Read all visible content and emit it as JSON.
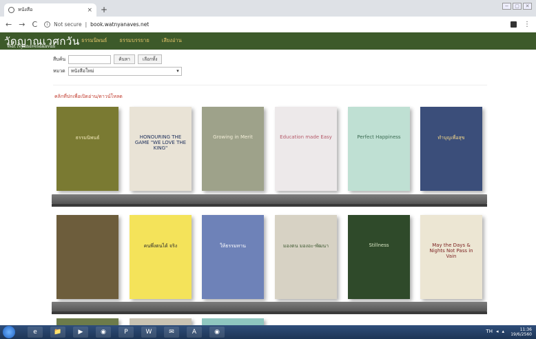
{
  "browser": {
    "tab_title": "หนังสือ",
    "tab_close": "×",
    "new_tab": "+",
    "security": "Not secure",
    "url": "book.watnyanaves.net",
    "win_buttons": [
      "−",
      "▢",
      "✕"
    ]
  },
  "site": {
    "logo_th": "วัดญาณเวศกวัน",
    "logo_en": "Wat Nyanavesakavan",
    "menu": [
      "ธรรมนิพนธ์",
      "ธรรมบรรยาย",
      "เสียงอ่าน"
    ]
  },
  "search": {
    "label": "สืบค้น",
    "search_btn": "ค้นหา",
    "reset_btn": "เลือกทั้ง",
    "cat_label": "หมวด",
    "cat_value": "หนังสือใหม่",
    "cat_arrow": "▾"
  },
  "hint": "คลิกที่ปกเพื่อเปิดอ่าน/ดาวน์โหลด",
  "books_row1": [
    {
      "title": "ธรรมนิพนธ์",
      "bg": "#7a7a32",
      "fg": "#f1e7b8"
    },
    {
      "title": "HONOURING THE GAME \"WE LOVE THE KING\"",
      "bg": "#e9e3d6",
      "fg": "#1b2d5a"
    },
    {
      "title": "Growing in Merit",
      "bg": "#9ea28a",
      "fg": "#f3eed8"
    },
    {
      "title": "Education made Easy",
      "bg": "#ede9ea",
      "fg": "#b55a6a"
    },
    {
      "title": "Perfect Happiness",
      "bg": "#bfe0d3",
      "fg": "#3b6b52"
    },
    {
      "title": "ทำบุญเพื่อสุข",
      "bg": "#3b4e7a",
      "fg": "#f5d88a"
    }
  ],
  "books_row2": [
    {
      "title": "",
      "bg": "#6d5d3c",
      "fg": "#f1e7b8"
    },
    {
      "title": "คนพึ่งตนได้ จริง",
      "bg": "#f4e35a",
      "fg": "#2b2b2b"
    },
    {
      "title": "ให้ธรรมทาน",
      "bg": "#6e82b8",
      "fg": "#ffffff"
    },
    {
      "title": "มองตน มองอะ-พัฒนา",
      "bg": "#d7d2c4",
      "fg": "#3f5a32"
    },
    {
      "title": "Stillness",
      "bg": "#2f4a2a",
      "fg": "#d9e6c4"
    },
    {
      "title": "May the Days & Nights Not Pass in Vain",
      "bg": "#ece6d3",
      "fg": "#7a1f1f"
    }
  ],
  "taskbar": {
    "items": [
      "e",
      "📁",
      "▶",
      "◉",
      "P",
      "W",
      "✉",
      "A",
      "◉"
    ],
    "lang": "TH",
    "time": "11:36",
    "date": "19/6/2560"
  }
}
